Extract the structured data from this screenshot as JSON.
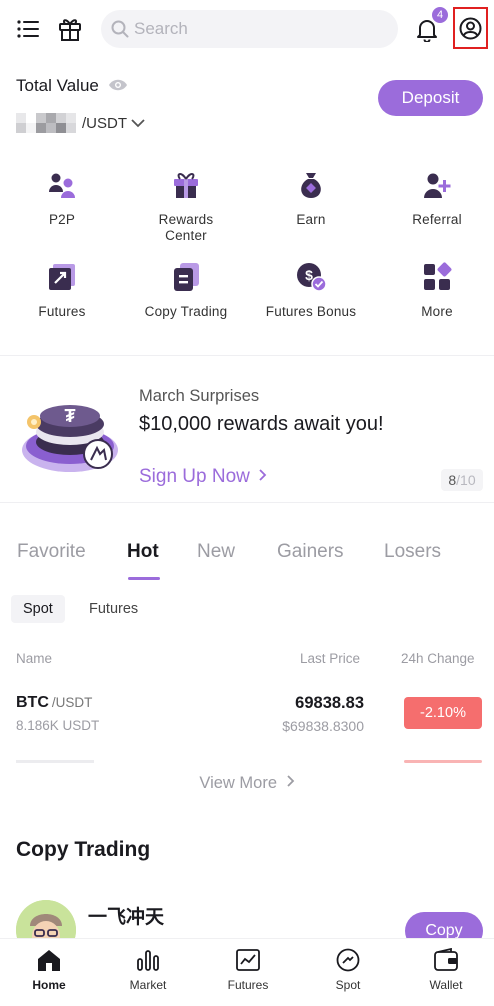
{
  "header": {
    "search_placeholder": "Search",
    "notification_count": "4",
    "icons": [
      "menu-icon",
      "gift-icon",
      "search-icon",
      "bell-icon",
      "user-profile-icon"
    ]
  },
  "account": {
    "total_value_label": "Total Value",
    "balance_unit": "/USDT",
    "deposit_label": "Deposit"
  },
  "quick_actions": [
    {
      "label": "P2P",
      "icon": "p2p-icon"
    },
    {
      "label": "Rewards Center",
      "icon": "gift-box-icon"
    },
    {
      "label": "Earn",
      "icon": "money-bag-icon"
    },
    {
      "label": "Referral",
      "icon": "add-user-icon"
    },
    {
      "label": "Futures",
      "icon": "futures-chart-icon"
    },
    {
      "label": "Copy Trading",
      "icon": "copy-document-icon"
    },
    {
      "label": "Futures Bonus",
      "icon": "bonus-coin-icon"
    },
    {
      "label": "More",
      "icon": "grid-more-icon"
    }
  ],
  "banner": {
    "subtitle": "March Surprises",
    "title": "$10,000 rewards await you!",
    "cta": "Sign Up Now",
    "page_current": "8",
    "page_total": "/10"
  },
  "market_tabs": [
    "Favorite",
    "Hot",
    "New",
    "Gainers",
    "Losers"
  ],
  "active_market_tab": "Hot",
  "sub_tabs": [
    "Spot",
    "Futures"
  ],
  "table": {
    "headers": {
      "name": "Name",
      "price": "Last Price",
      "change": "24h Change"
    },
    "rows": [
      {
        "base": "BTC",
        "quote": "/USDT",
        "volume": "8.186K USDT",
        "price": "69838.83",
        "fiat": "$69838.8300",
        "change": "-2.10%"
      }
    ],
    "view_more": "View More"
  },
  "copy_trading": {
    "title": "Copy Trading",
    "trader_name": "一飞冲天",
    "copy_label": "Copy"
  },
  "bottom_nav": [
    {
      "label": "Home",
      "icon": "home-icon"
    },
    {
      "label": "Market",
      "icon": "market-bars-icon"
    },
    {
      "label": "Futures",
      "icon": "futures-icon"
    },
    {
      "label": "Spot",
      "icon": "spot-icon"
    },
    {
      "label": "Wallet",
      "icon": "wallet-icon"
    }
  ],
  "colors": {
    "accent": "#9b6cdb",
    "negative": "#f56e6e",
    "alert": "#e02020"
  }
}
